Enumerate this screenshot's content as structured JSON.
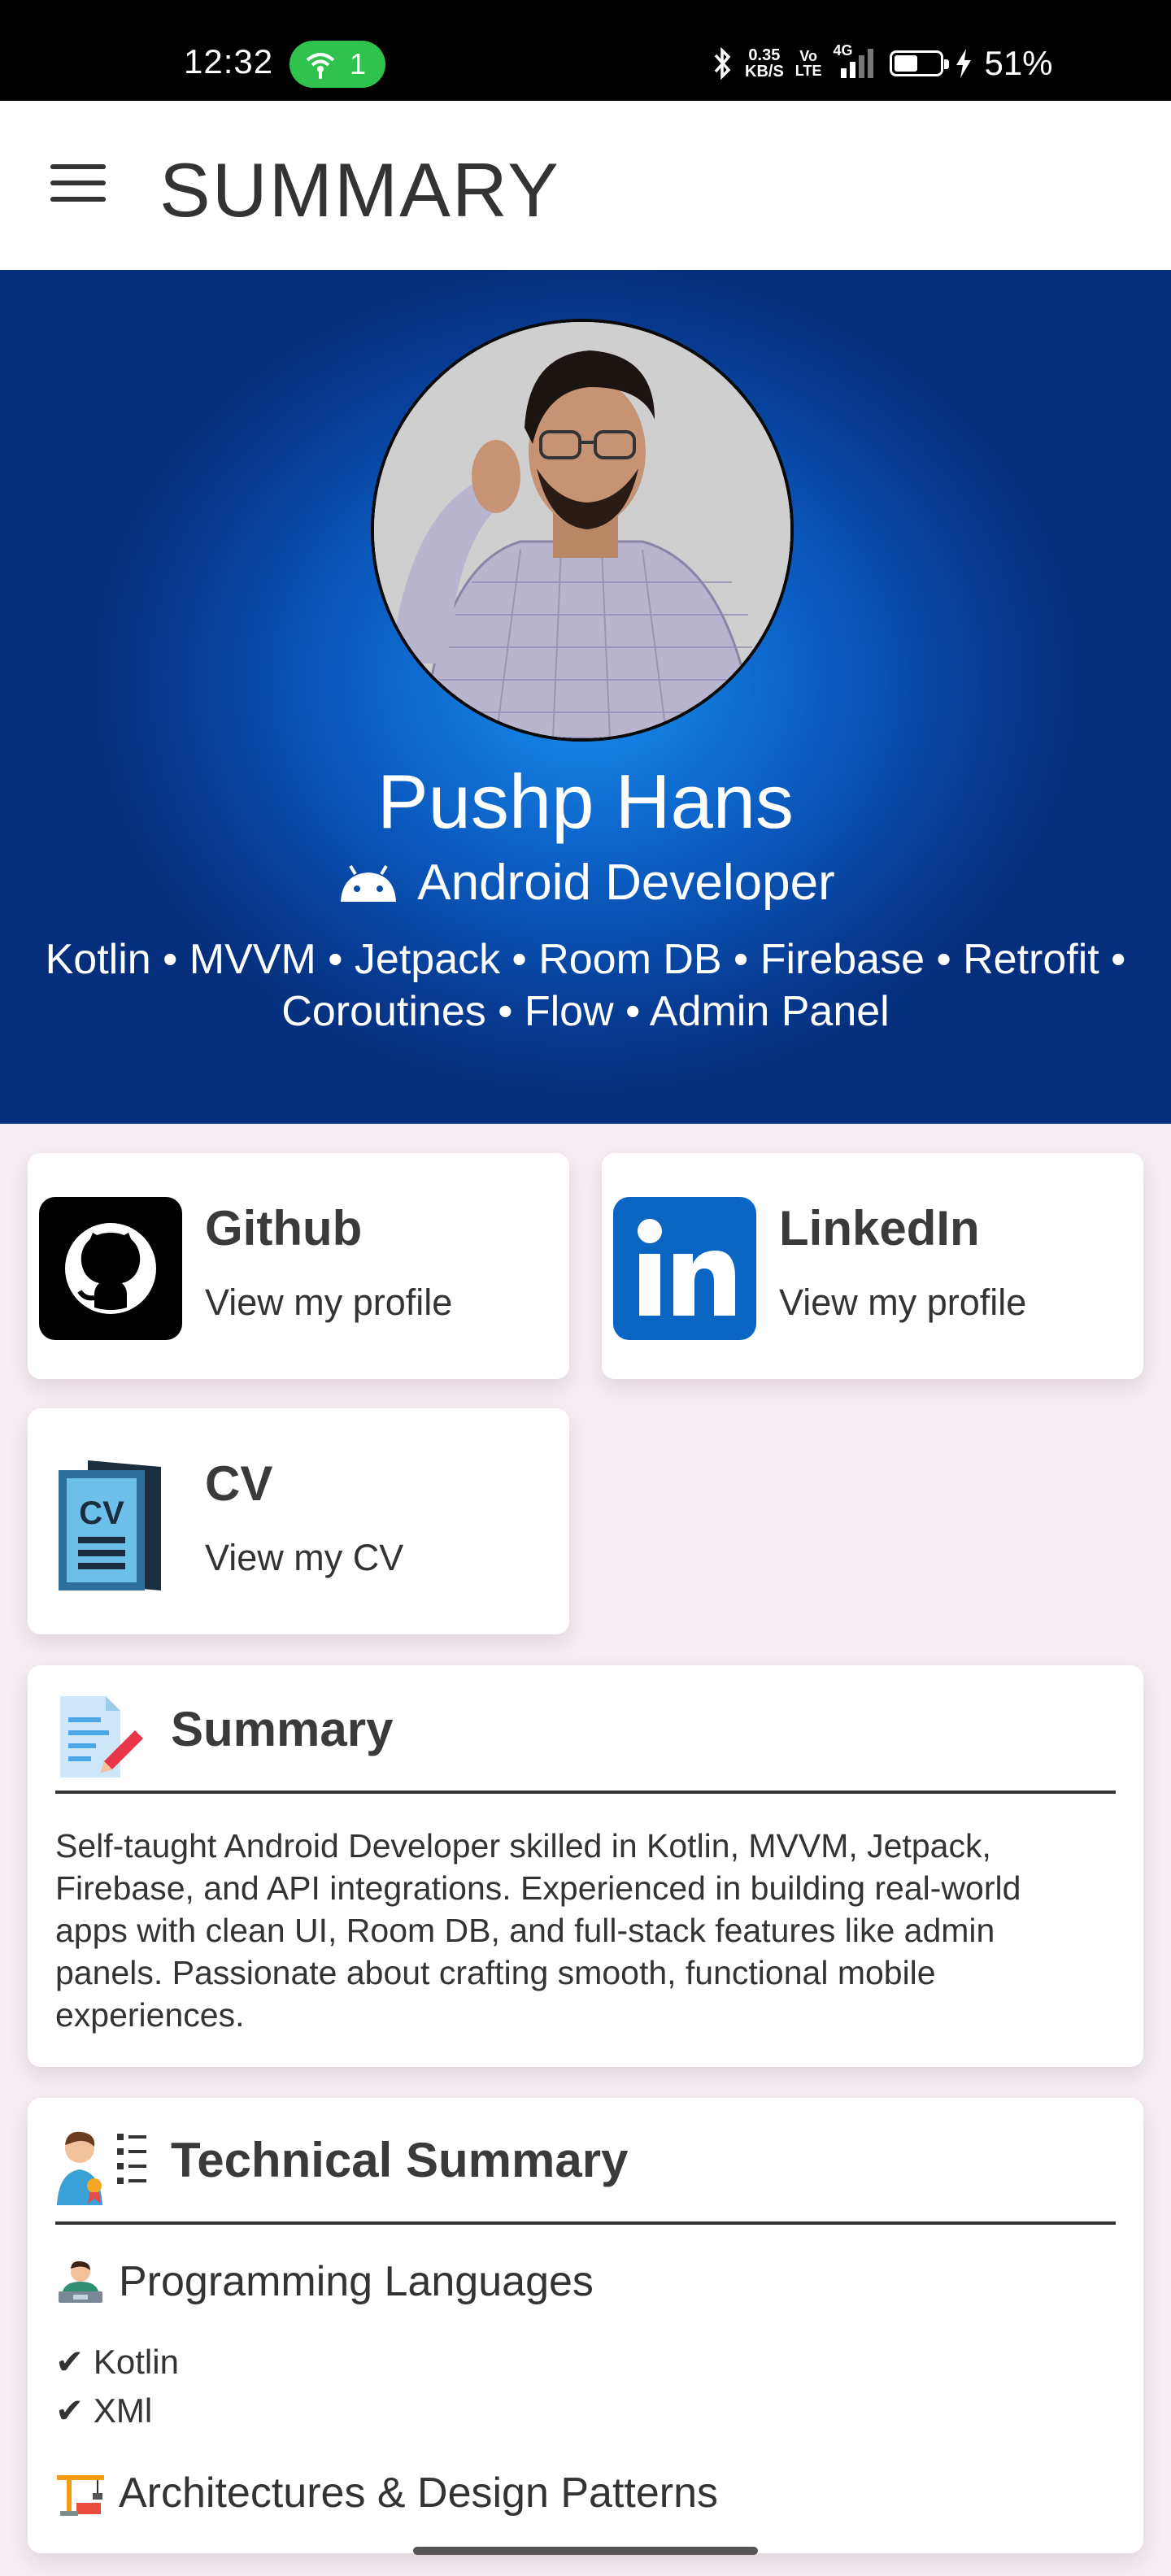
{
  "status_bar": {
    "time": "12:32",
    "hotspot_count": "1",
    "net_speed_value": "0.35",
    "net_speed_unit": "KB/S",
    "volte_top": "Vo",
    "volte_bottom": "LTE",
    "network": "4G",
    "battery": "51%",
    "battery_level": 0.51
  },
  "app_bar": {
    "title": "SUMMARY",
    "menu_icon": "hamburger-menu-icon"
  },
  "profile": {
    "name": "Pushp Hans",
    "role": "Android Developer",
    "role_icon": "android-icon",
    "skills_line1": "Kotlin • MVVM • Jetpack • Room DB • Firebase • Retrofit •",
    "skills_line2": "Coroutines • Flow • Admin Panel"
  },
  "links": [
    {
      "title": "Github",
      "subtitle": "View my profile",
      "icon": "github-icon"
    },
    {
      "title": "LinkedIn",
      "subtitle": "View my profile",
      "icon": "linkedin-icon"
    },
    {
      "title": "CV",
      "subtitle": "View my CV",
      "icon": "cv-document-icon"
    }
  ],
  "summary": {
    "title": "Summary",
    "text": "Self-taught Android Developer skilled in Kotlin, MVVM, Jetpack, Firebase, and API integrations. Experienced in building real-world apps with clean UI, Room DB, and full-stack features like admin panels. Passionate about crafting smooth, functional mobile experiences."
  },
  "technical_summary": {
    "title": "Technical Summary",
    "programming_languages_title": "Programming Languages",
    "languages": [
      "Kotlin",
      "XMl"
    ],
    "architectures_title": "Architectures & Design Patterns"
  },
  "colors": {
    "hero_dark": "#052f7c",
    "hero_light": "#1a8ff0",
    "hotspot_green": "#2fc24d",
    "linkedin_blue": "#0a66c2"
  }
}
